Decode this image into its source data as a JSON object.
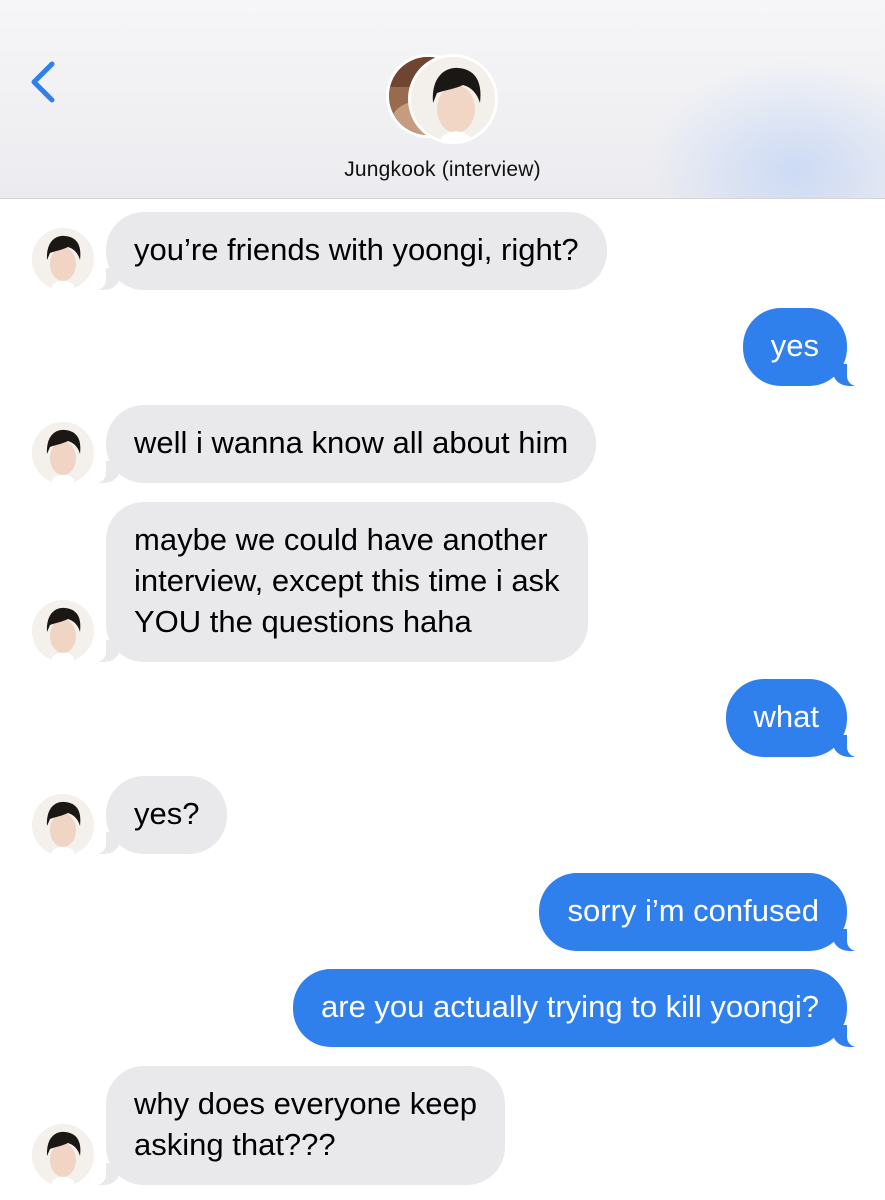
{
  "header": {
    "back_icon": "chevron-left-icon",
    "contact_name": "Jungkook (interview)",
    "accent_color": "#2f80ed"
  },
  "messages": [
    {
      "from": "them",
      "text": "you’re friends with yoongi, right?"
    },
    {
      "from": "me",
      "text": "yes"
    },
    {
      "from": "them",
      "text": "well i wanna know all about him"
    },
    {
      "from": "them",
      "text": "maybe we could have another\ninterview, except this time i ask\nYOU the questions haha"
    },
    {
      "from": "me",
      "text": "what"
    },
    {
      "from": "them",
      "text": "yes?"
    },
    {
      "from": "me",
      "text": "sorry i’m confused"
    },
    {
      "from": "me",
      "text": "are you actually trying to kill yoongi?"
    },
    {
      "from": "them",
      "text": "why does everyone keep\nasking that???"
    }
  ]
}
